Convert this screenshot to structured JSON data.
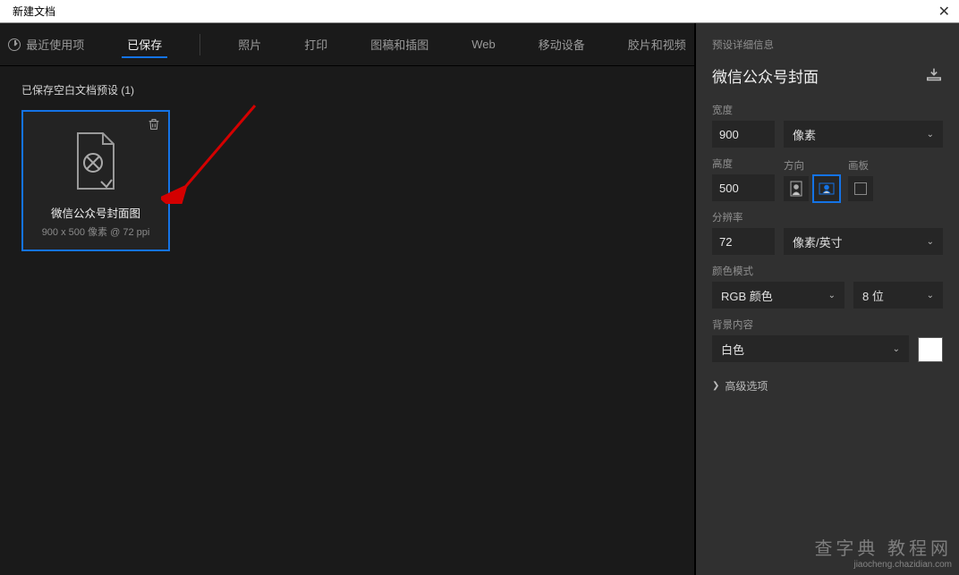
{
  "window": {
    "title": "新建文档"
  },
  "tabs": [
    {
      "label": "最近使用项"
    },
    {
      "label": "已保存"
    },
    {
      "label": "照片"
    },
    {
      "label": "打印"
    },
    {
      "label": "图稿和插图"
    },
    {
      "label": "Web"
    },
    {
      "label": "移动设备"
    },
    {
      "label": "胶片和视频"
    }
  ],
  "presets": {
    "section_label": "已保存空白文档预设 (1)",
    "items": [
      {
        "name": "微信公众号封面图",
        "meta": "900 x 500 像素 @ 72 ppi"
      }
    ]
  },
  "details": {
    "header": "预设详细信息",
    "name": "微信公众号封面",
    "width_label": "宽度",
    "width_value": "900",
    "width_unit": "像素",
    "height_label": "高度",
    "height_value": "500",
    "orientation_label": "方向",
    "artboard_label": "画板",
    "resolution_label": "分辨率",
    "resolution_value": "72",
    "resolution_unit": "像素/英寸",
    "color_mode_label": "颜色模式",
    "color_mode_value": "RGB 颜色",
    "bit_depth": "8 位",
    "background_label": "背景内容",
    "background_value": "白色",
    "advanced": "高级选项"
  },
  "watermark": {
    "line1": "查字典  教程网",
    "line2": "jiaocheng.chazidian.com"
  }
}
